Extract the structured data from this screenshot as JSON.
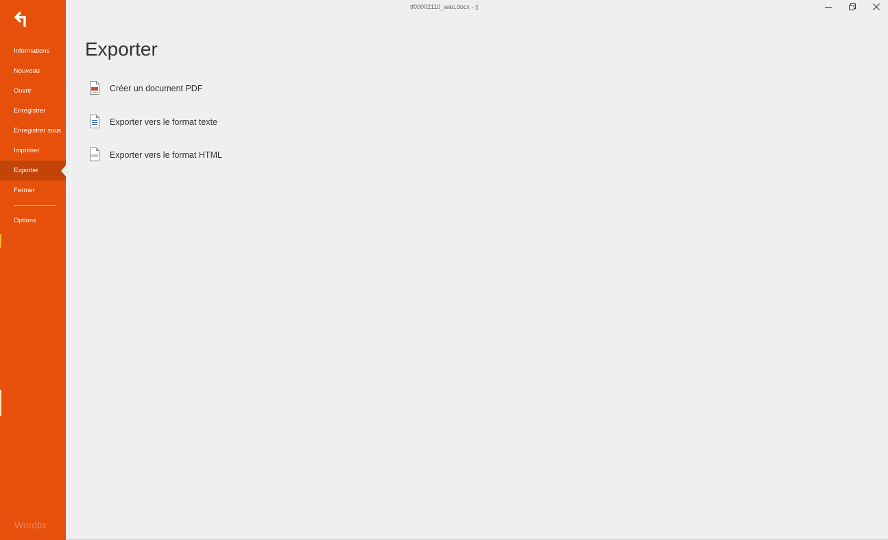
{
  "window": {
    "title": "tf00002110_wac.docx - ▯",
    "minimize_icon": "minimize-icon",
    "restore_icon": "restore-icon",
    "close_icon": "close-icon"
  },
  "sidebar": {
    "back_icon": "back-arrow-icon",
    "items": [
      {
        "label": "Informations",
        "active": false
      },
      {
        "label": "Nouveau",
        "active": false
      },
      {
        "label": "Ouvrir",
        "active": false
      },
      {
        "label": "Enregistrer",
        "active": false
      },
      {
        "label": "Enregistrer sous",
        "active": false
      },
      {
        "label": "Imprimer",
        "active": false
      },
      {
        "label": "Exporter",
        "active": true
      },
      {
        "label": "Fermer",
        "active": false
      }
    ],
    "options_label": "Options",
    "brand": "Wordtix"
  },
  "main": {
    "title": "Exporter",
    "items": [
      {
        "label": "Créer un document PDF",
        "icon": "pdf-file-icon"
      },
      {
        "label": "Exporter vers le format texte",
        "icon": "text-file-icon"
      },
      {
        "label": "Exporter vers le format HTML",
        "icon": "html-file-icon"
      }
    ]
  },
  "colors": {
    "accent": "#e6500a",
    "accent_active": "#c24408",
    "background": "#efefef"
  }
}
